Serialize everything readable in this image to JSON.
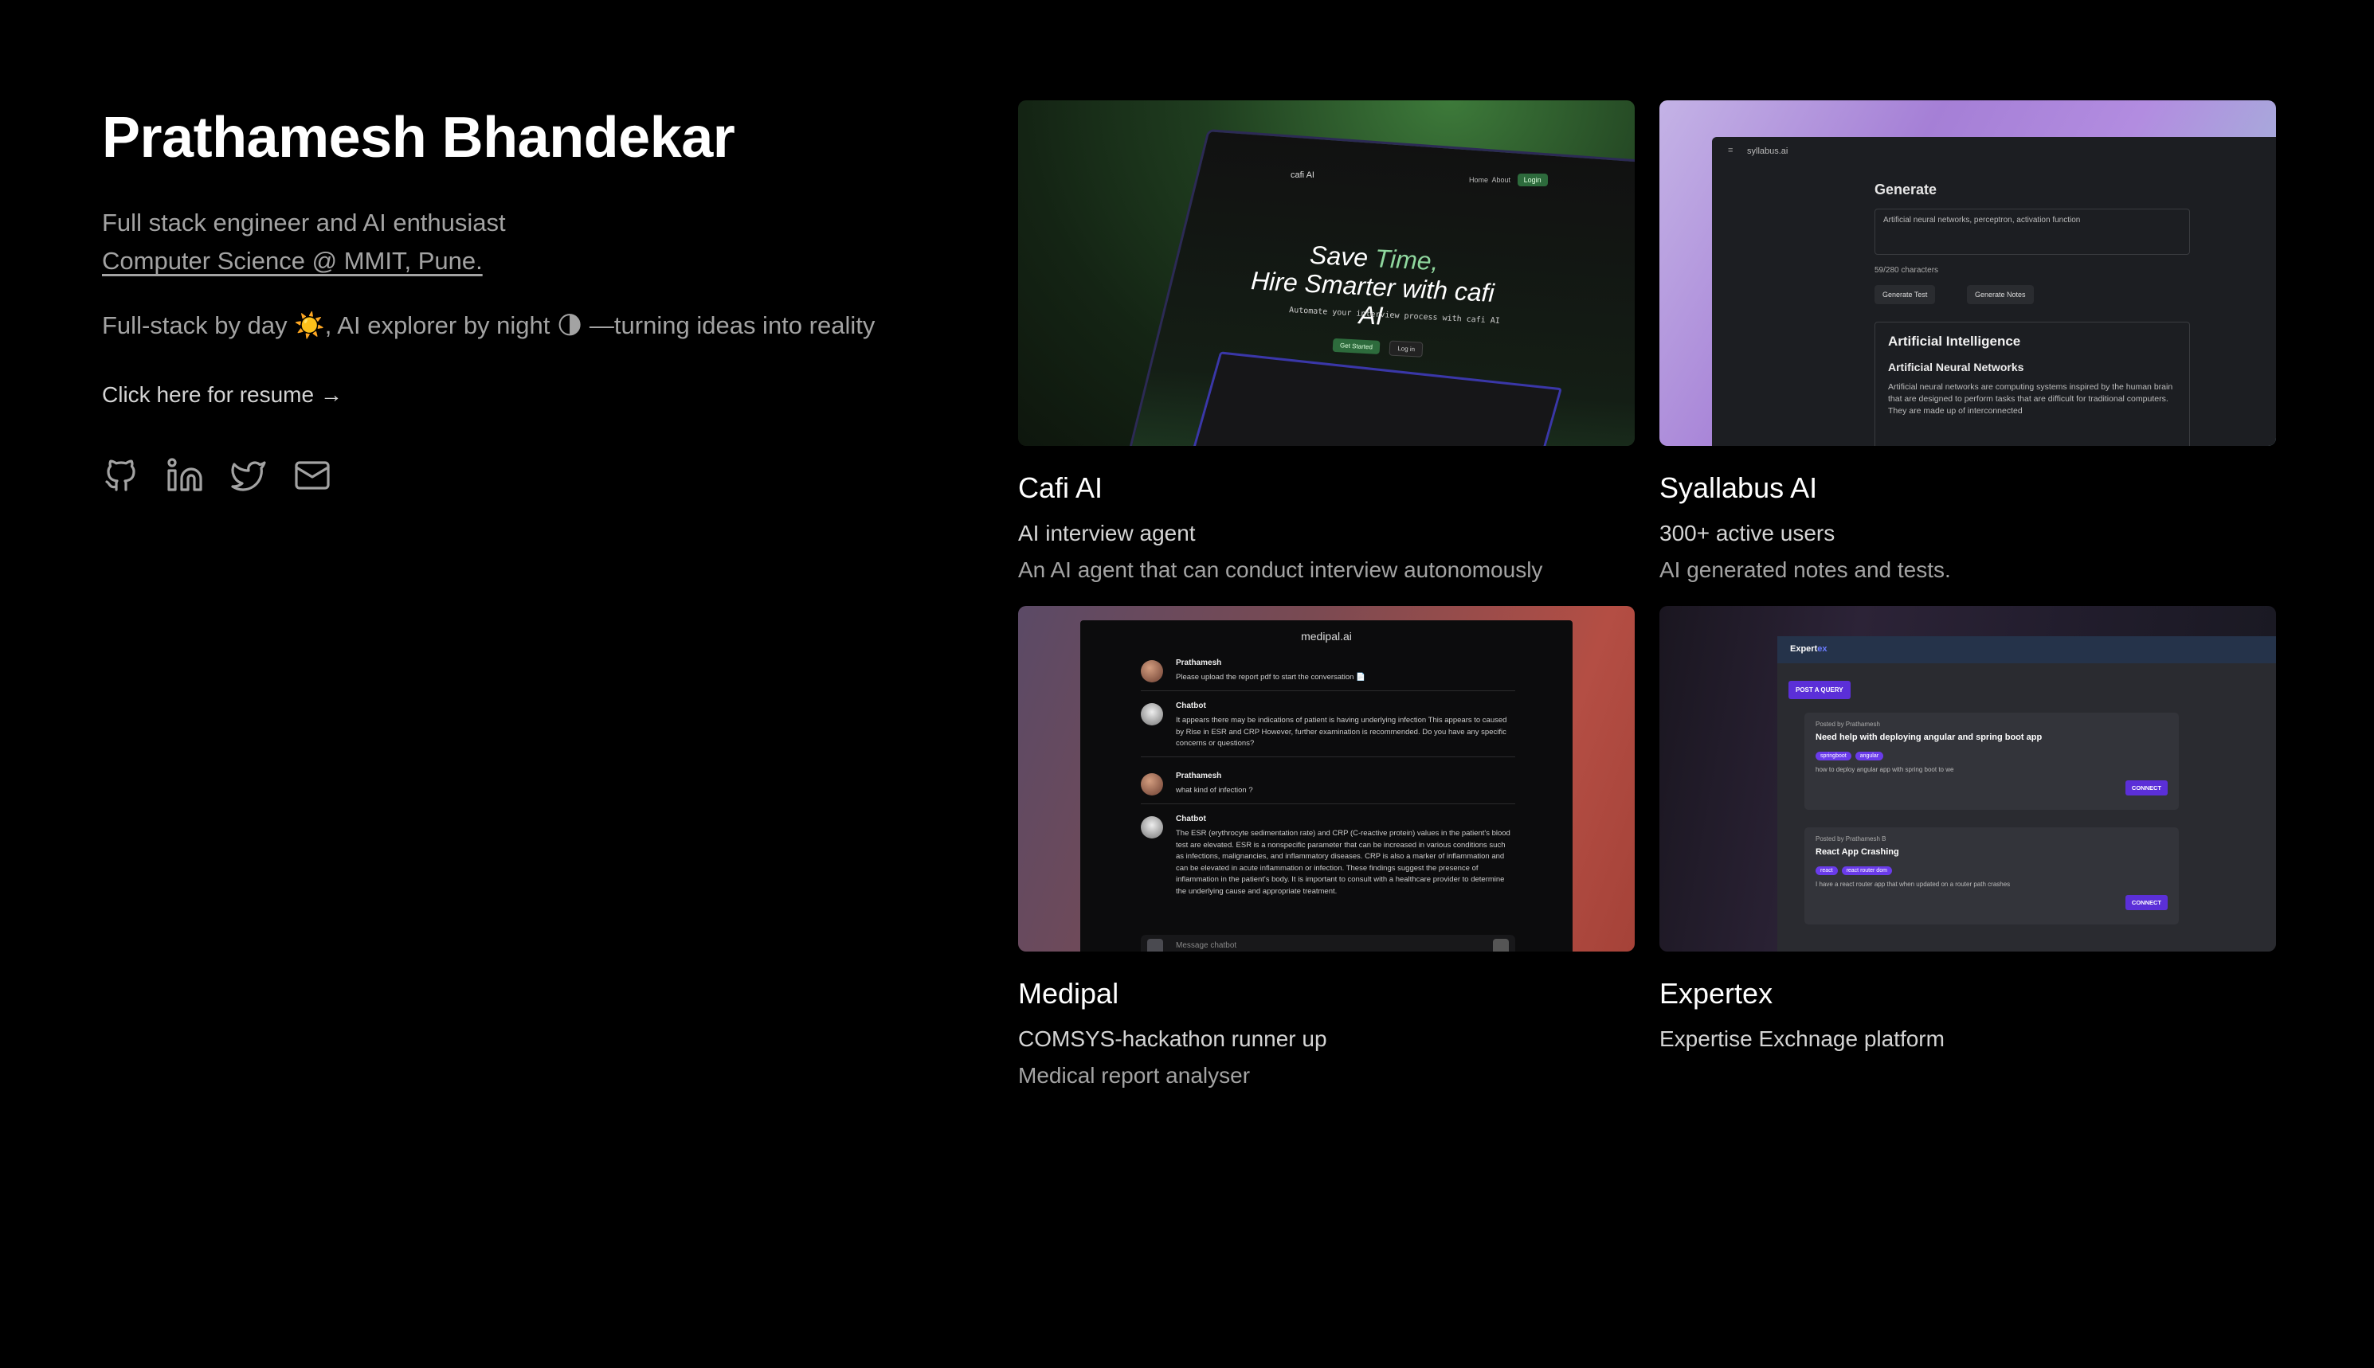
{
  "profile": {
    "name": "Prathamesh Bhandekar",
    "subtitle": "Full stack engineer and AI enthusiast",
    "department_link": "Computer Science @ MMIT, Pune.",
    "tagline": "Full-stack by day ☀️, AI explorer by night 🌗 —turning ideas into reality",
    "resume_link": "Click here for resume →",
    "socials": [
      {
        "name": "github-icon"
      },
      {
        "name": "linkedin-icon"
      },
      {
        "name": "twitter-icon"
      },
      {
        "name": "mail-icon"
      }
    ]
  },
  "projects": [
    {
      "title": "Cafi AI",
      "line1": "AI interview agent",
      "line2": "An AI agent that can conduct interview autonomously",
      "preview": {
        "logo": "cafi AI",
        "nav": [
          "Home",
          "About"
        ],
        "login": "Login",
        "headline_1a": "Save ",
        "headline_1b": "Time,",
        "headline_2": "Hire Smarter with cafi AI",
        "sub": "Automate your interview process with cafi AI",
        "btn1": "Get Started",
        "btn2": "Log in"
      }
    },
    {
      "title": "Syallabus AI",
      "line1": "300+ active users",
      "line2": "AI generated notes and tests.",
      "preview": {
        "menu": "≡",
        "brand": "syllabus.ai",
        "heading": "Generate",
        "input": "Artificial neural networks, perceptron, activation function",
        "count": "59/280 characters",
        "btn1": "Generate Test",
        "btn2": "Generate Notes",
        "out_h2": "Artificial Intelligence",
        "out_h3": "Artificial Neural Networks",
        "out_p": "Artificial neural networks are computing systems inspired by the human brain that are designed to perform tasks that are difficult for traditional computers. They are made up of interconnected"
      }
    },
    {
      "title": "Medipal",
      "line1": "COMSYS-hackathon runner up",
      "line2": "Medical report analyser",
      "preview": {
        "app_title": "medipal.ai",
        "messages": [
          {
            "name": "Prathamesh",
            "text": "Please upload the report pdf to start the conversation 📄"
          },
          {
            "name": "Chatbot",
            "text": "It appears there may be indications of patient is having underlying infection This appears to caused by Rise in ESR and CRP However, further examination is recommended. Do you have any specific concerns or questions?"
          },
          {
            "name": "Prathamesh",
            "text": "what kind of infection ?"
          },
          {
            "name": "Chatbot",
            "text": "The ESR (erythrocyte sedimentation rate) and CRP (C-reactive protein) values in the patient's blood test are elevated. ESR is a nonspecific parameter that can be increased in various conditions such as infections, malignancies, and inflammatory diseases. CRP is also a marker of inflammation and can be elevated in acute inflammation or infection. These findings suggest the presence of inflammation in the patient's body. It is important to consult with a healthcare provider to determine the underlying cause and appropriate treatment."
          }
        ],
        "placeholder": "Message chatbot"
      }
    },
    {
      "title": "Expertex",
      "line1": "Expertise Exchnage platform",
      "line2": "",
      "preview": {
        "logo_a": "Expert",
        "logo_b": "ex",
        "post_btn": "POST A QUERY",
        "queries": [
          {
            "by": "Posted by Prathamesh",
            "title": "Need help with deploying angular and spring boot app",
            "tags": [
              "springboot",
              "angular"
            ],
            "desc": "how to deploy angular app with spring boot to we",
            "connect": "CONNECT"
          },
          {
            "by": "Posted by Prathamesh B",
            "title": "React App Crashing",
            "tags": [
              "react",
              "react router dom"
            ],
            "desc": "I have a react router app that when updated on a router path crashes",
            "connect": "CONNECT"
          }
        ]
      }
    }
  ]
}
